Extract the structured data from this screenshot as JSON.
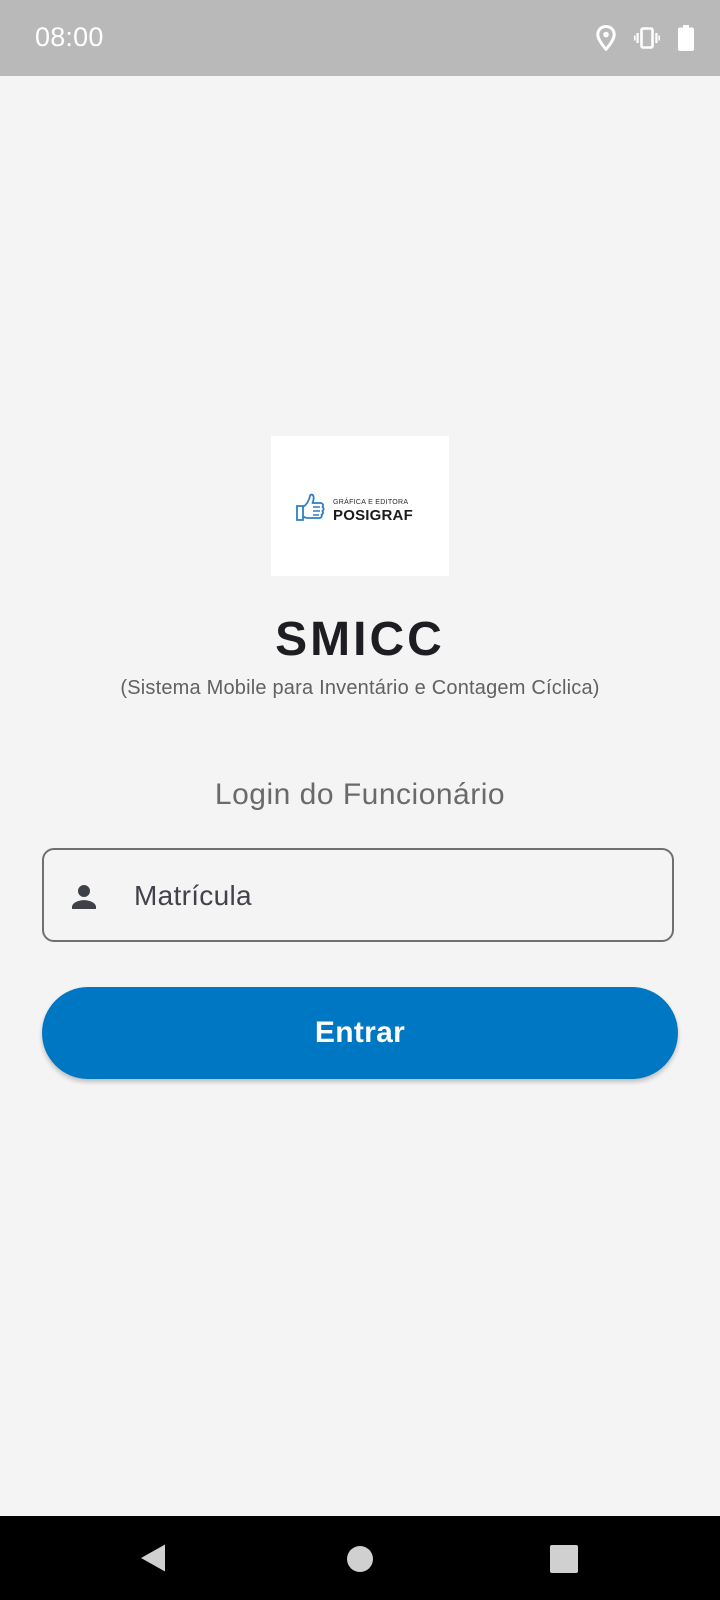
{
  "status_bar": {
    "time": "08:00",
    "icons": [
      "location-pin-icon",
      "vibrate-icon",
      "battery-icon"
    ]
  },
  "logo": {
    "alt": "Gráfica e Editora Posigraf logo",
    "subtitle": "GRÁFICA E EDITORA",
    "brand": "POSIGRAF",
    "accent_color": "#2f7fc4"
  },
  "app": {
    "title": "SMICC",
    "subtitle": "(Sistema Mobile para Inventário e Contagem Cíclica)"
  },
  "login": {
    "heading": "Login do Funcionário",
    "matricula_label": "Matrícula",
    "field_icon": "person-icon",
    "submit_label": "Entrar"
  },
  "colors": {
    "primary": "#0077c3",
    "background": "#f4f4f5",
    "status_bar": "#b9b9b9"
  },
  "nav_bar": {
    "icons": [
      "back-icon",
      "home-icon",
      "recents-icon"
    ]
  }
}
